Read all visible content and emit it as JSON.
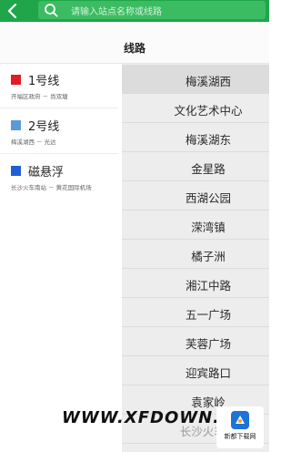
{
  "header": {
    "search_placeholder": "请输入站点名称或线路"
  },
  "page": {
    "title": "线路"
  },
  "lines": [
    {
      "name": "1号线",
      "route": "开福区政府 － 尚双塘",
      "color": "#e31c23"
    },
    {
      "name": "2号线",
      "route": "梅溪湖西 － 光达",
      "color": "#5b9bd5"
    },
    {
      "name": "磁悬浮",
      "route": "长沙火车南站 － 黄花国际机场",
      "color": "#1f5fd6"
    }
  ],
  "stations": [
    {
      "name": "梅溪湖西",
      "selected": true
    },
    {
      "name": "文化艺术中心"
    },
    {
      "name": "梅溪湖东"
    },
    {
      "name": "金星路"
    },
    {
      "name": "西湖公园"
    },
    {
      "name": "溁湾镇"
    },
    {
      "name": "橘子洲"
    },
    {
      "name": "湘江中路"
    },
    {
      "name": "五一广场"
    },
    {
      "name": "芙蓉广场"
    },
    {
      "name": "迎宾路口"
    },
    {
      "name": "袁家岭"
    },
    {
      "name": "长沙火车站"
    }
  ],
  "watermark": {
    "text": "WWW.XFDOWN.COM",
    "badge": "新都下载网"
  },
  "colors": {
    "header_bg": "#1fa64a",
    "list_bg": "#ededed"
  }
}
